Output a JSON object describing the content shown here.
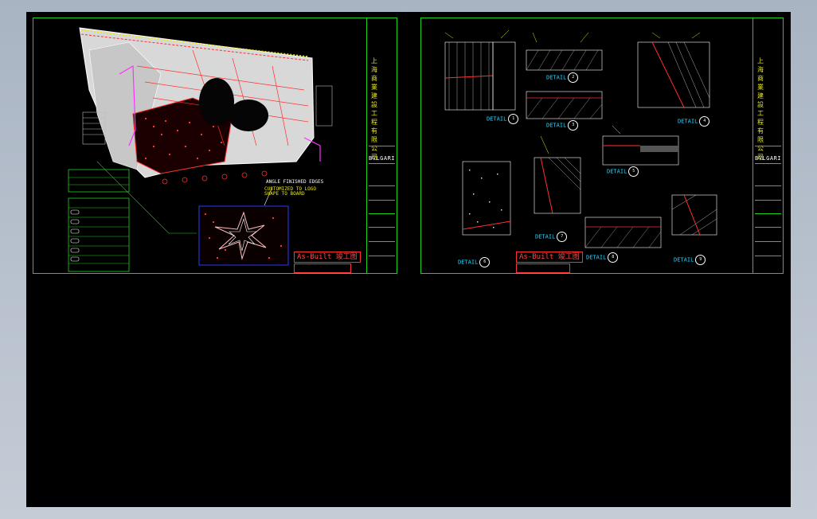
{
  "viewer": {
    "background_color": "#000000",
    "frame_color": "#b8c1cd"
  },
  "colors": {
    "border": "#1fd11f",
    "text": "#e8e81a",
    "accent": "#ff3030",
    "detail": "#22d3ff"
  },
  "left_sheet": {
    "title_block": {
      "company_vertical": "上海商業建設工程有限公司",
      "brand": "BVLGARI"
    },
    "asbuilt_label": "As-Built 竣工图",
    "callout": "CUSTOMIZED TO LOGO\nSHAPE TO BOARD",
    "note_label": "ANGLE FINISHED EDGES"
  },
  "right_sheet": {
    "title_block": {
      "company_vertical": "上海商業建設工程有限公司",
      "brand": "BVLGARI"
    },
    "asbuilt_label": "As-Built 竣工图",
    "details": [
      {
        "label": "DETAIL",
        "num": "1"
      },
      {
        "label": "DETAIL",
        "num": "2"
      },
      {
        "label": "DETAIL",
        "num": "3"
      },
      {
        "label": "DETAIL",
        "num": "4"
      },
      {
        "label": "DETAIL",
        "num": "5"
      },
      {
        "label": "DETAIL",
        "num": "6"
      },
      {
        "label": "DETAIL",
        "num": "7"
      },
      {
        "label": "DETAIL",
        "num": "8"
      },
      {
        "label": "DETAIL",
        "num": "9"
      }
    ]
  }
}
